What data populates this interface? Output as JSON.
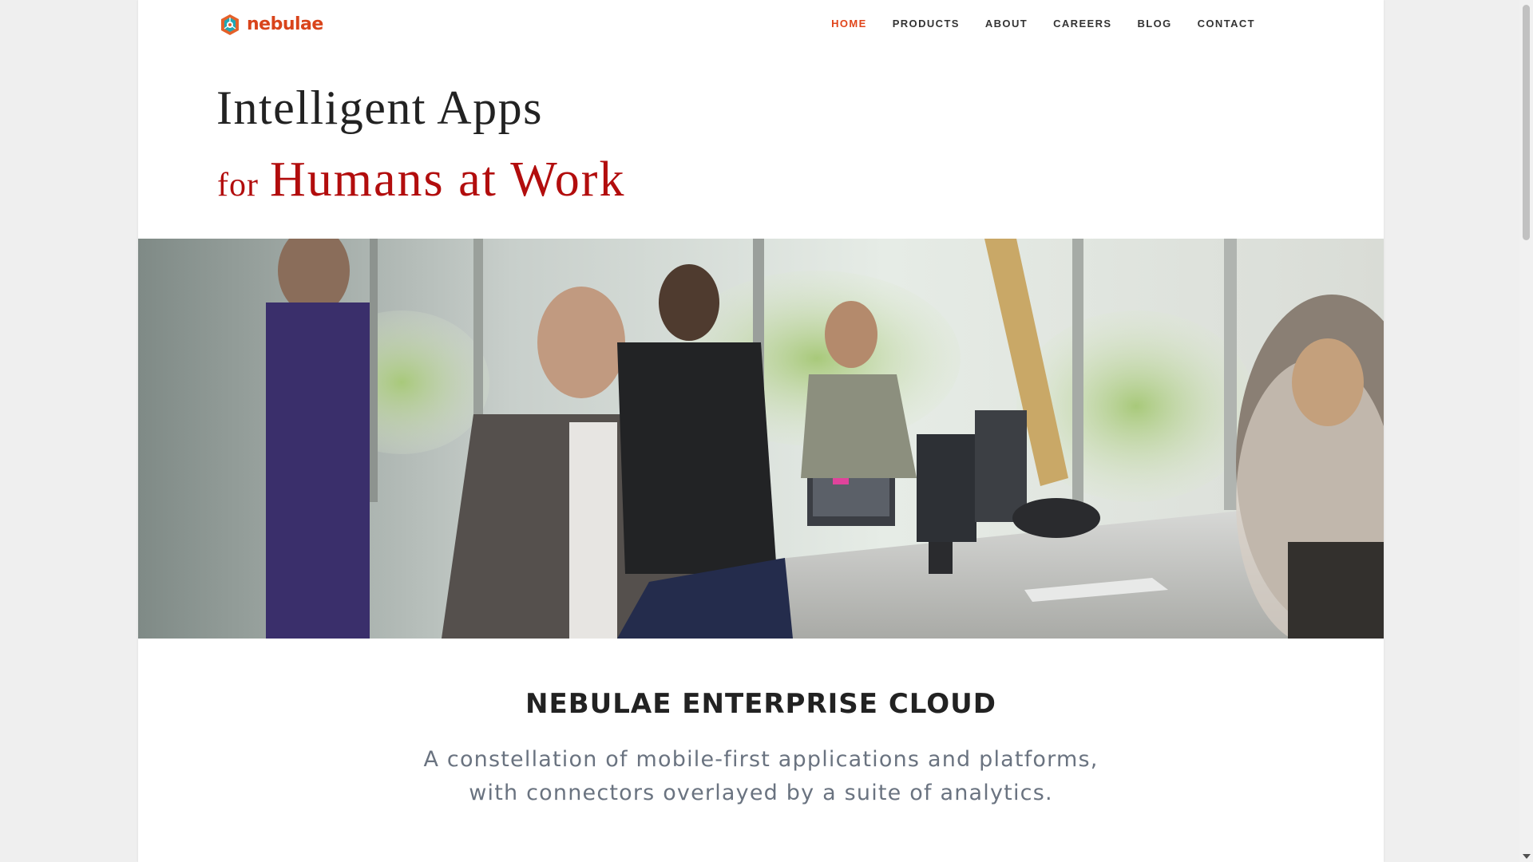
{
  "header": {
    "logo_text": "nebulae",
    "nav": [
      {
        "label": "HOME",
        "active": true
      },
      {
        "label": "PRODUCTS",
        "active": false
      },
      {
        "label": "ABOUT",
        "active": false
      },
      {
        "label": "CAREERS",
        "active": false
      },
      {
        "label": "BLOG",
        "active": false
      },
      {
        "label": "CONTACT",
        "active": false
      }
    ]
  },
  "hero": {
    "line1": "Intelligent Apps",
    "line2_prefix": "for",
    "line2_main": "Humans at Work",
    "image_description_icon": "office-team-photo"
  },
  "section": {
    "title": "NEBULAE ENTERPRISE CLOUD",
    "text_line1": "A constellation of mobile-first applications and platforms,",
    "text_line2": "with connectors overlayed by a suite of analytics."
  },
  "colors": {
    "accent": "#e0451b",
    "hero_red": "#b20d0d",
    "logo": "#d9441b",
    "body_text": "#6a7380"
  }
}
